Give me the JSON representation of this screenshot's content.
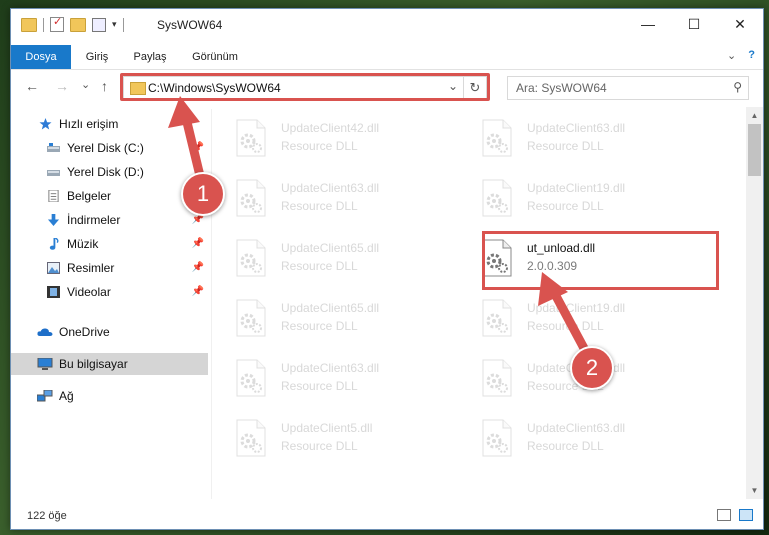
{
  "window": {
    "title": "SysWOW64",
    "controls": {
      "minimize": "—",
      "maximize": "☐",
      "close": "✕"
    }
  },
  "ribbon": {
    "tabs": [
      {
        "label": "Dosya",
        "active": true
      },
      {
        "label": "Giriş"
      },
      {
        "label": "Paylaş"
      },
      {
        "label": "Görünüm"
      }
    ],
    "expand": "⌄",
    "help": "?"
  },
  "nav": {
    "back": "←",
    "forward": "→",
    "recent": "⌄",
    "up": "↑",
    "address": "C:\\Windows\\SysWOW64",
    "address_dropdown": "⌄",
    "refresh": "↻",
    "search_placeholder": "Ara: SysWOW64",
    "search_icon": "⚲"
  },
  "sidebar": {
    "items": [
      {
        "label": "Hızlı erişim",
        "icon": "star-icon"
      },
      {
        "label": "Yerel Disk (C:)",
        "icon": "drive-icon",
        "pinned": true
      },
      {
        "label": "Yerel Disk (D:)",
        "icon": "drive-icon"
      },
      {
        "label": "Belgeler",
        "icon": "documents-icon"
      },
      {
        "label": "İndirmeler",
        "icon": "download-icon",
        "pinned": true
      },
      {
        "label": "Müzik",
        "icon": "music-icon",
        "pinned": true
      },
      {
        "label": "Resimler",
        "icon": "pictures-icon",
        "pinned": true
      },
      {
        "label": "Videolar",
        "icon": "videos-icon",
        "pinned": true
      },
      {
        "label": "OneDrive",
        "icon": "cloud-icon"
      },
      {
        "label": "Bu bilgisayar",
        "icon": "computer-icon",
        "selected": true
      },
      {
        "label": "Ağ",
        "icon": "network-icon"
      }
    ],
    "pin_glyph": "📌"
  },
  "files": {
    "items": [
      {
        "name": "UpdateClient42.dll",
        "type": "Resource DLL",
        "faded": true
      },
      {
        "name": "UpdateClient63.dll",
        "type": "Resource DLL",
        "faded": true
      },
      {
        "name": "UpdateClient63.dll",
        "type": "Resource DLL",
        "faded": true
      },
      {
        "name": "UpdateClient19.dll",
        "type": "Resource DLL",
        "faded": true
      },
      {
        "name": "UpdateClient65.dll",
        "type": "Resource DLL",
        "faded": true
      },
      {
        "name": "ut_unload.dll",
        "type": "2.0.0.309",
        "faded": false
      },
      {
        "name": "UpdateClient65.dll",
        "type": "Resource DLL",
        "faded": true
      },
      {
        "name": "UpdateClient19.dll",
        "type": "Resource DLL",
        "faded": true
      },
      {
        "name": "UpdateClient63.dll",
        "type": "Resource DLL",
        "faded": true
      },
      {
        "name": "UpdateClient63.dll",
        "type": "Resource DLL",
        "faded": true
      },
      {
        "name": "UpdateClient5.dll",
        "type": "Resource DLL",
        "faded": true
      },
      {
        "name": "UpdateClient63.dll",
        "type": "Resource DLL",
        "faded": true
      }
    ]
  },
  "status": {
    "count": "122 öğe"
  },
  "annotations": {
    "step1": "1",
    "step2": "2",
    "color": "#d9534f"
  }
}
